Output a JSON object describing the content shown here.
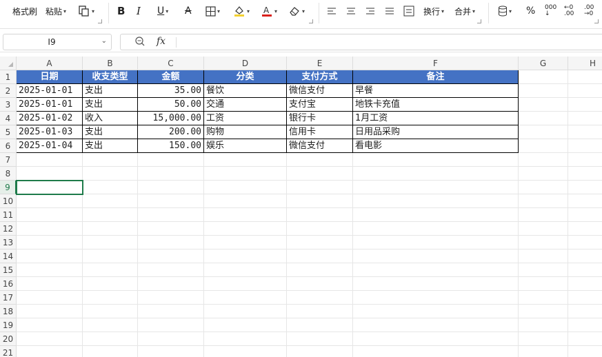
{
  "ribbon": {
    "format_painter": "格式刷",
    "paste": "粘贴",
    "wrap": "换行",
    "merge": "合并"
  },
  "formula_bar": {
    "name_box": "I9",
    "fx": "fx",
    "value": ""
  },
  "sheet": {
    "columns": [
      {
        "label": "A",
        "width": 96
      },
      {
        "label": "B",
        "width": 80
      },
      {
        "label": "C",
        "width": 96
      },
      {
        "label": "D",
        "width": 120
      },
      {
        "label": "E",
        "width": 96
      },
      {
        "label": "F",
        "width": 240
      },
      {
        "label": "G",
        "width": 72
      },
      {
        "label": "H",
        "width": 72
      }
    ],
    "row_count": 21,
    "selected_row": 9,
    "header": [
      "日期",
      "收支类型",
      "金额",
      "分类",
      "支付方式",
      "备注"
    ],
    "rows": [
      [
        "2025-01-01",
        "支出",
        "35.00",
        "餐饮",
        "微信支付",
        "早餐"
      ],
      [
        "2025-01-01",
        "支出",
        "50.00",
        "交通",
        "支付宝",
        "地铁卡充值"
      ],
      [
        "2025-01-02",
        "收入",
        "15,000.00",
        "工资",
        "银行卡",
        "1月工资"
      ],
      [
        "2025-01-03",
        "支出",
        "200.00",
        "购物",
        "信用卡",
        "日用品采购"
      ],
      [
        "2025-01-04",
        "支出",
        "150.00",
        "娱乐",
        "微信支付",
        "看电影"
      ]
    ]
  },
  "colors": {
    "header_fill": "#4472c4",
    "selection": "#1e7b4a"
  }
}
